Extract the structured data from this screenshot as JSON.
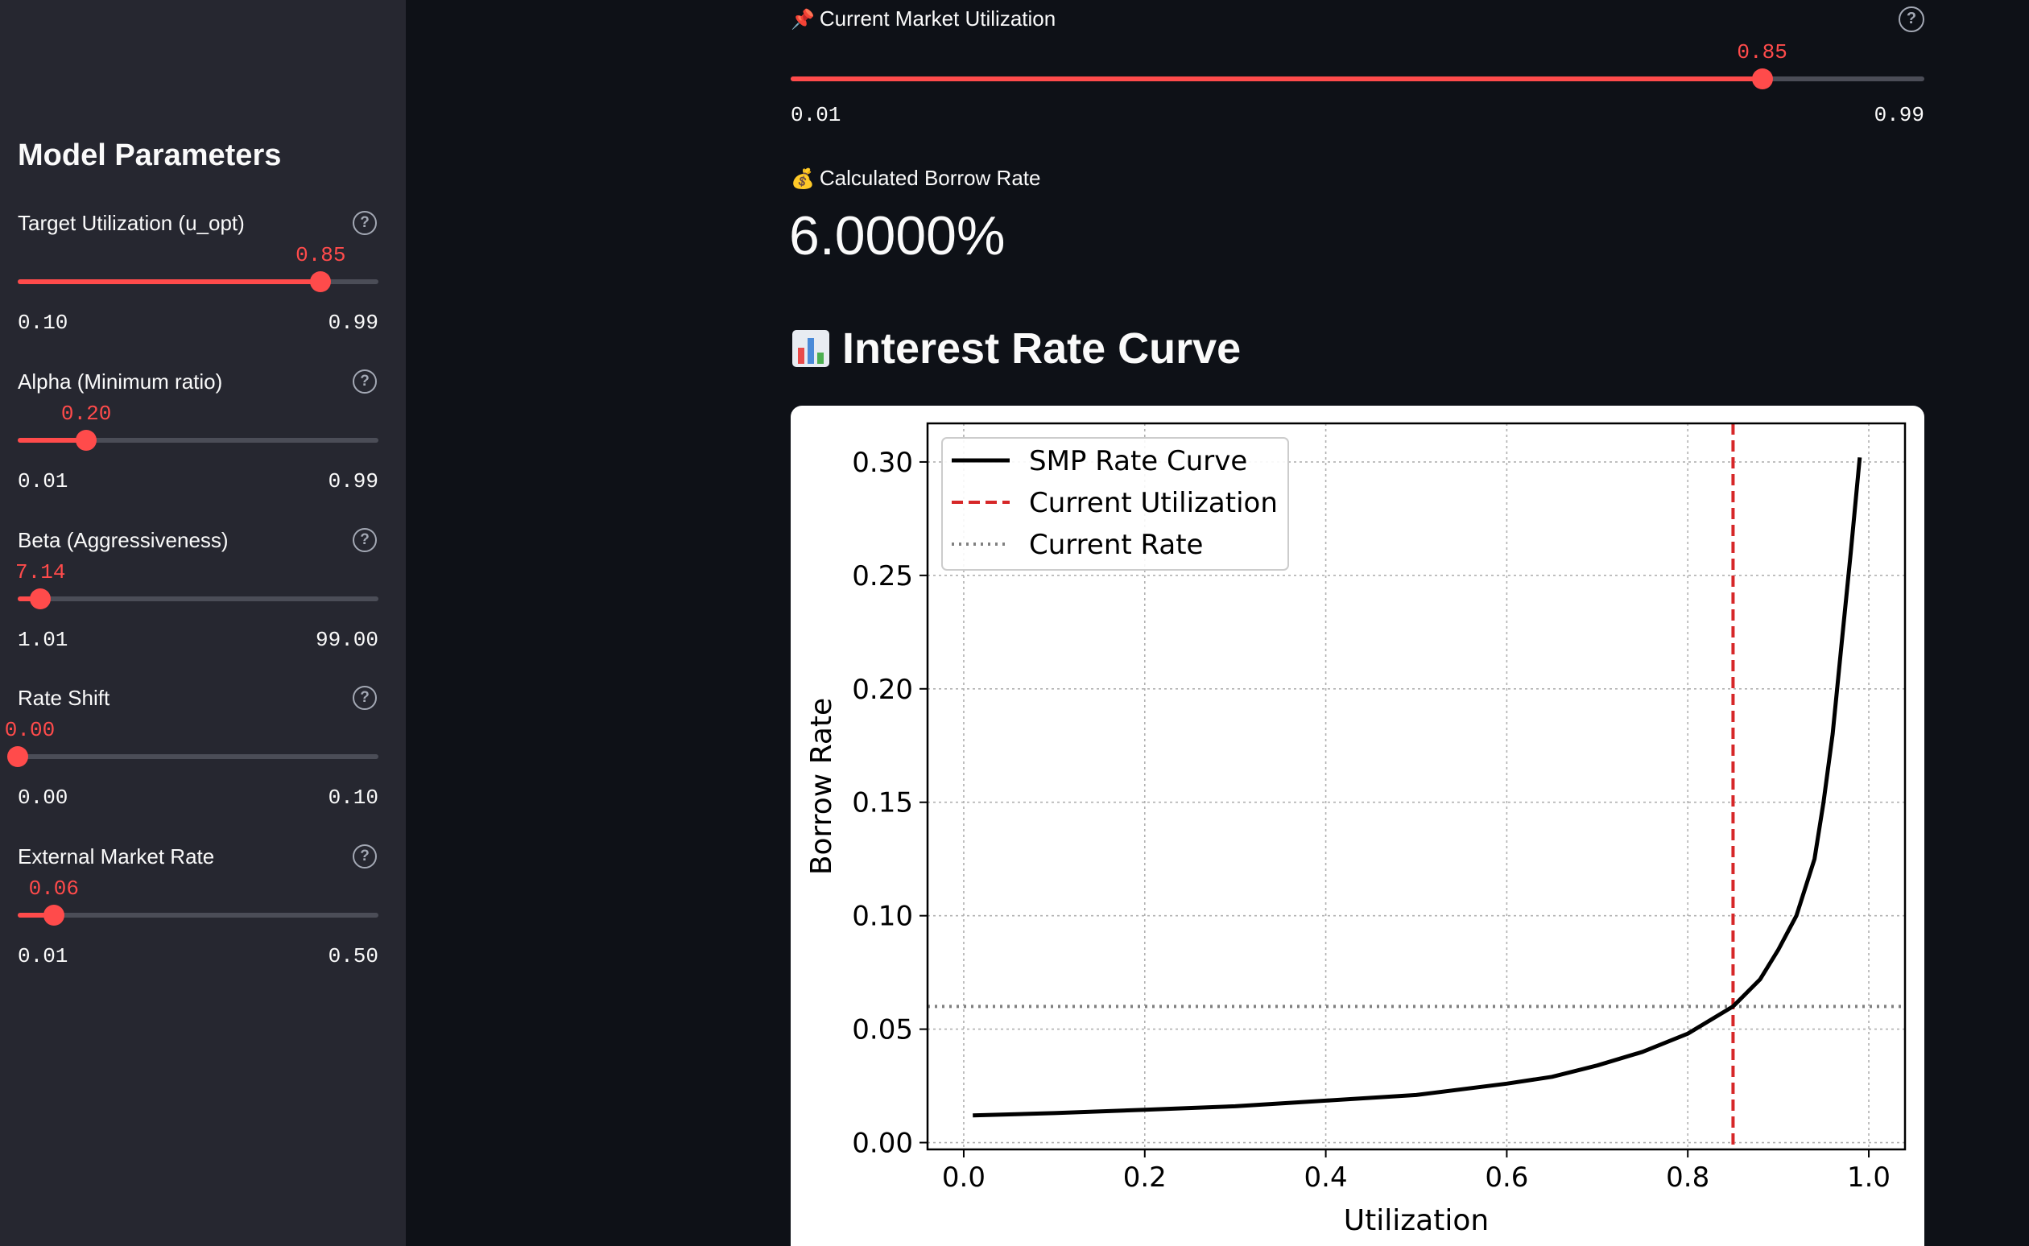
{
  "sidebar": {
    "title": "Model Parameters",
    "params": [
      {
        "label": "Target Utilization (u_opt)",
        "value": "0.85",
        "min": "0.10",
        "max": "0.99",
        "fraction": 0.84
      },
      {
        "label": "Alpha (Minimum ratio)",
        "value": "0.20",
        "min": "0.01",
        "max": "0.99",
        "fraction": 0.19
      },
      {
        "label": "Beta (Aggressiveness)",
        "value": "7.14",
        "min": "1.01",
        "max": "99.00",
        "fraction": 0.063
      },
      {
        "label": "Rate Shift",
        "value": "0.00",
        "min": "0.00",
        "max": "0.10",
        "fraction": 0.0
      },
      {
        "label": "External Market Rate",
        "value": "0.06",
        "min": "0.01",
        "max": "0.50",
        "fraction": 0.1
      }
    ],
    "help_glyph": "?"
  },
  "main_slider": {
    "label": "Current Market Utilization",
    "icon": "pushpin-icon",
    "value": "0.85",
    "min": "0.01",
    "max": "0.99",
    "fraction": 0.857
  },
  "metric": {
    "label": "Calculated Borrow Rate",
    "icon": "money-bag-icon",
    "value": "6.0000%"
  },
  "section": {
    "title": "Interest Rate Curve",
    "icon": "bar-chart-icon"
  },
  "colors": {
    "accent": "#ff4b4b",
    "sidebar_bg": "#262730",
    "main_bg": "#0e1117"
  },
  "chart_data": {
    "type": "line",
    "xlabel": "Utilization",
    "ylabel": "Borrow Rate",
    "xlim": [
      -0.04,
      1.04
    ],
    "ylim": [
      -0.003,
      0.317
    ],
    "xticks": [
      "0.0",
      "0.2",
      "0.4",
      "0.6",
      "0.8",
      "1.0"
    ],
    "xtick_values": [
      0.0,
      0.2,
      0.4,
      0.6,
      0.8,
      1.0
    ],
    "yticks": [
      "0.00",
      "0.05",
      "0.10",
      "0.15",
      "0.20",
      "0.25",
      "0.30"
    ],
    "ytick_values": [
      0.0,
      0.05,
      0.1,
      0.15,
      0.2,
      0.25,
      0.3
    ],
    "grid": true,
    "legend_position": "upper-left",
    "series": [
      {
        "name": "SMP Rate Curve",
        "style": "solid",
        "color": "#000000",
        "x": [
          0.01,
          0.1,
          0.2,
          0.3,
          0.4,
          0.5,
          0.6,
          0.65,
          0.7,
          0.75,
          0.8,
          0.85,
          0.88,
          0.9,
          0.92,
          0.94,
          0.95,
          0.96,
          0.97,
          0.98,
          0.99
        ],
        "y": [
          0.012,
          0.013,
          0.0145,
          0.016,
          0.0185,
          0.021,
          0.026,
          0.029,
          0.034,
          0.04,
          0.048,
          0.06,
          0.072,
          0.085,
          0.1,
          0.125,
          0.15,
          0.18,
          0.22,
          0.26,
          0.302
        ]
      },
      {
        "name": "Current Utilization",
        "style": "dashed",
        "color": "#d62728",
        "vline_x": 0.85
      },
      {
        "name": "Current Rate",
        "style": "dotted",
        "color": "#808080",
        "hline_y": 0.06
      }
    ]
  }
}
